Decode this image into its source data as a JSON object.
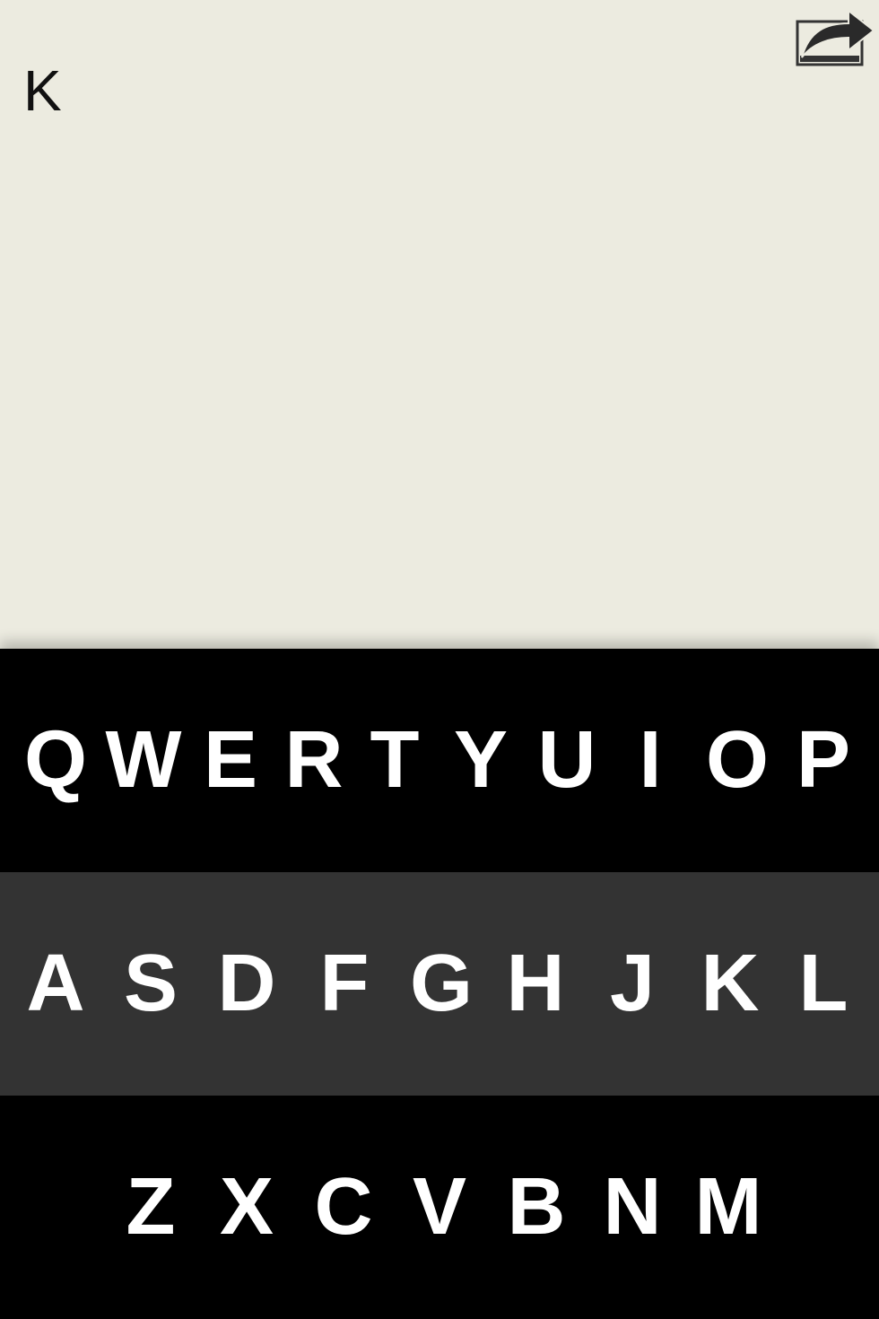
{
  "editor": {
    "text": "K"
  },
  "toolbar": {
    "share_icon": "share-arrow-icon"
  },
  "keyboard": {
    "rows": [
      [
        "Q",
        "W",
        "E",
        "R",
        "T",
        "Y",
        "U",
        "I",
        "O",
        "P"
      ],
      [
        "A",
        "S",
        "D",
        "F",
        "G",
        "H",
        "J",
        "K",
        "L"
      ],
      [
        "Z",
        "X",
        "C",
        "V",
        "B",
        "N",
        "M"
      ]
    ]
  },
  "colors": {
    "background": "#ecebe0",
    "row_dark": "#000000",
    "row_highlight": "#333333",
    "key_text": "#ffffff"
  }
}
